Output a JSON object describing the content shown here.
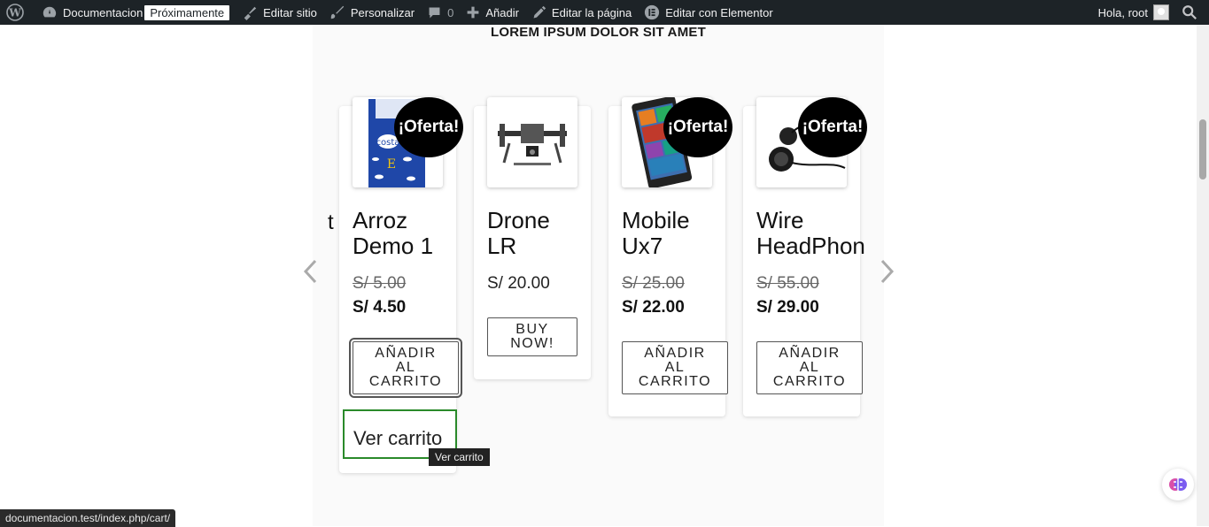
{
  "adminbar": {
    "site_name": "Documentacion",
    "badge": "Próximamente",
    "edit_site": "Editar sitio",
    "customize": "Personalizar",
    "comments_count": "0",
    "add_new": "Añadir",
    "edit_page": "Editar la página",
    "elementor": "Editar con Elementor",
    "greeting": "Hola, root"
  },
  "section": {
    "title": "LOREM IPSUM DOLOR SIT AMET",
    "partial_char": "t"
  },
  "products": [
    {
      "name_line1": "Arroz",
      "name_line2": "Demo 1",
      "sale_badge": "¡Oferta!",
      "old_price": "S/ 5.00",
      "price": "S/ 4.50",
      "button": [
        "AÑADIR",
        "AL",
        "CARRITO"
      ]
    },
    {
      "name_line1": "Drone",
      "name_line2": "LR",
      "price": "S/ 20.00",
      "button": [
        "BUY",
        "NOW!"
      ]
    },
    {
      "name_line1": "Mobile",
      "name_line2": "Ux7",
      "sale_badge": "¡Oferta!",
      "old_price": "S/ 25.00",
      "price": "S/ 22.00",
      "button": [
        "AÑADIR",
        "AL",
        "CARRITO"
      ]
    },
    {
      "name_line1": "Wire",
      "name_line2": "HeadPhon",
      "sale_badge": "¡Oferta!",
      "old_price": "S/ 55.00",
      "price": "S/ 29.00",
      "button": [
        "AÑADIR",
        "AL",
        "CARRITO"
      ]
    }
  ],
  "view_cart": "Ver carrito",
  "tooltip": "Ver carrito",
  "status_url": "documentacion.test/index.php/cart/",
  "colors": {
    "adminbar_bg": "#1d2327",
    "focus_green": "#2a8a2a",
    "sale_bg": "#000000"
  }
}
